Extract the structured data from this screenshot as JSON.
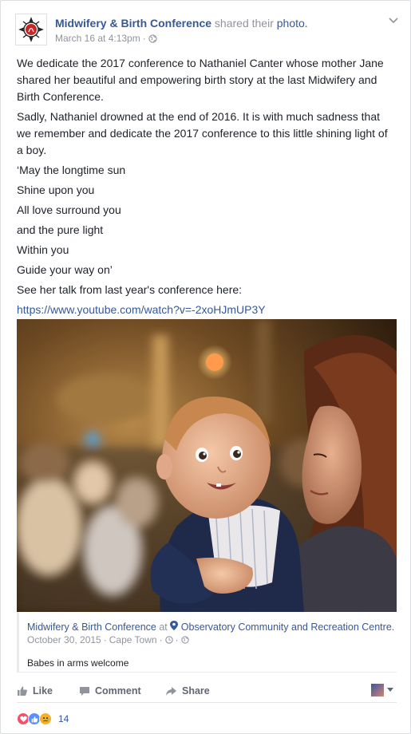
{
  "post": {
    "page_name": "Midwifery & Birth Conference",
    "action_text": "shared their",
    "action_link": "photo.",
    "timestamp": "March 16 at 4:13pm",
    "separator": "·",
    "paragraphs": [
      "We dedicate the 2017 conference to Nathaniel Canter whose mother Jane shared her beautiful and empowering birth story at the last Midwifery and Birth Conference.",
      "Sadly, Nathaniel drowned at the end of 2016. It is with much sadness that we remember and dedicate the 2017 conference to this little shining light of a boy.",
      "‘May the longtime sun",
      "Shine upon you",
      "All love surround you",
      "and the pure light",
      "Within you",
      "Guide your way on’",
      "See her talk from last year's conference here:"
    ],
    "link": "https://www.youtube.com/watch?v=-2xoHJmUP3Y"
  },
  "attachment": {
    "page_name": "Midwifery & Birth Conference",
    "at": "at",
    "location": "Observatory Community and Recreation Centre.",
    "date": "October 30, 2015",
    "place": "Cape Town",
    "caption": "Babes in arms welcome"
  },
  "actions": {
    "like": "Like",
    "comment": "Comment",
    "share": "Share"
  },
  "reactions": {
    "count": "14",
    "types": [
      "love",
      "like",
      "sad"
    ]
  },
  "colors": {
    "link": "#365899",
    "meta": "#90949c",
    "like_blue": "#5890ff",
    "love_red": "#f25268",
    "sad_yellow": "#f7b125"
  }
}
